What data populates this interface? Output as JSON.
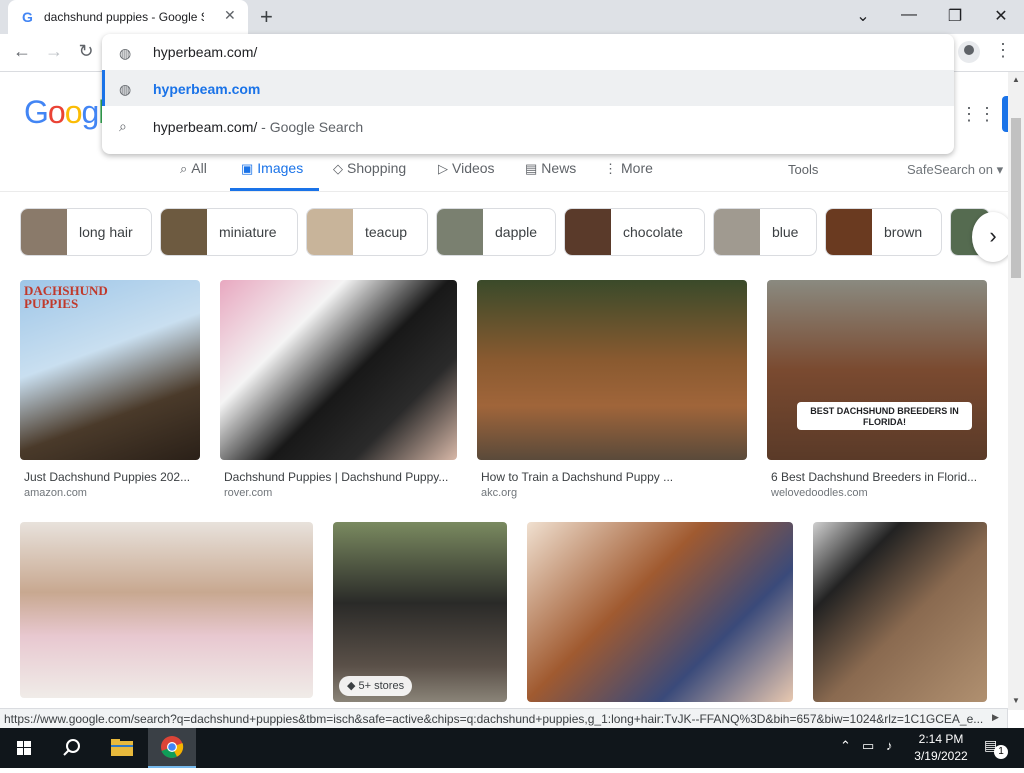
{
  "browser": {
    "tab_title": "dachshund puppies - Google Sea",
    "tab_favicon": "G",
    "new_tab_glyph": "+",
    "omnibox_value": "hyperbeam.com/",
    "suggestions": [
      {
        "text": "hyperbeam.com",
        "suffix": ""
      },
      {
        "text": "hyperbeam.com/",
        "suffix": " - Google Search"
      }
    ],
    "status_url": "https://www.google.com/search?q=dachshund+puppies&tbm=isch&safe=active&chips=q:dachshund+puppies,g_1:long+hair:TvJK--FFANQ%3D&bih=657&biw=1024&rlz=1C1GCEA_e..."
  },
  "google": {
    "logo_letters": [
      "G",
      "o",
      "o",
      "g",
      "l"
    ],
    "logo_colors": [
      "#4285f4",
      "#ea4335",
      "#fbbc05",
      "#4285f4",
      "#34a853"
    ],
    "tabs": [
      {
        "label": "All",
        "icon": "search-icon",
        "glyph": "⌕"
      },
      {
        "label": "Images",
        "icon": "image-icon",
        "glyph": "▣"
      },
      {
        "label": "Shopping",
        "icon": "tag-icon",
        "glyph": "◇"
      },
      {
        "label": "Videos",
        "icon": "play-icon",
        "glyph": "▷"
      },
      {
        "label": "News",
        "icon": "news-icon",
        "glyph": "▤"
      },
      {
        "label": "More",
        "icon": "more-icon",
        "glyph": "⋮"
      }
    ],
    "tools_label": "Tools",
    "safesearch_label": "SafeSearch on ▾",
    "accent": "#1a73e8"
  },
  "chips": [
    {
      "label": "long hair",
      "thumb": "#8a7a6a"
    },
    {
      "label": "miniature",
      "thumb": "#6d5a40"
    },
    {
      "label": "teacup",
      "thumb": "#c8b49a"
    },
    {
      "label": "dapple",
      "thumb": "#7a8070"
    },
    {
      "label": "chocolate",
      "thumb": "#5a3a2a"
    },
    {
      "label": "blue",
      "thumb": "#a09a90"
    },
    {
      "label": "brown",
      "thumb": "#6a3a20"
    }
  ],
  "results": [
    {
      "title": "Just Dachshund Puppies 202...",
      "site": "amazon.com",
      "overlay": "DACHSHUND PUPPIES"
    },
    {
      "title": "Dachshund Puppies | Dachshund Puppy...",
      "site": "rover.com"
    },
    {
      "title": "How to Train a Dachshund Puppy ...",
      "site": "akc.org"
    },
    {
      "title": "6 Best Dachshund Breeders in Florid...",
      "site": "welovedoodles.com",
      "overlay": "BEST DACHSHUND BREEDERS IN FLORIDA!"
    },
    {
      "title": "",
      "site": ""
    },
    {
      "title": "",
      "site": "",
      "badge": "5+ stores"
    },
    {
      "title": "",
      "site": ""
    },
    {
      "title": "",
      "site": ""
    }
  ],
  "taskbar": {
    "time": "2:14 PM",
    "date": "3/19/2022",
    "notifications": "1"
  }
}
